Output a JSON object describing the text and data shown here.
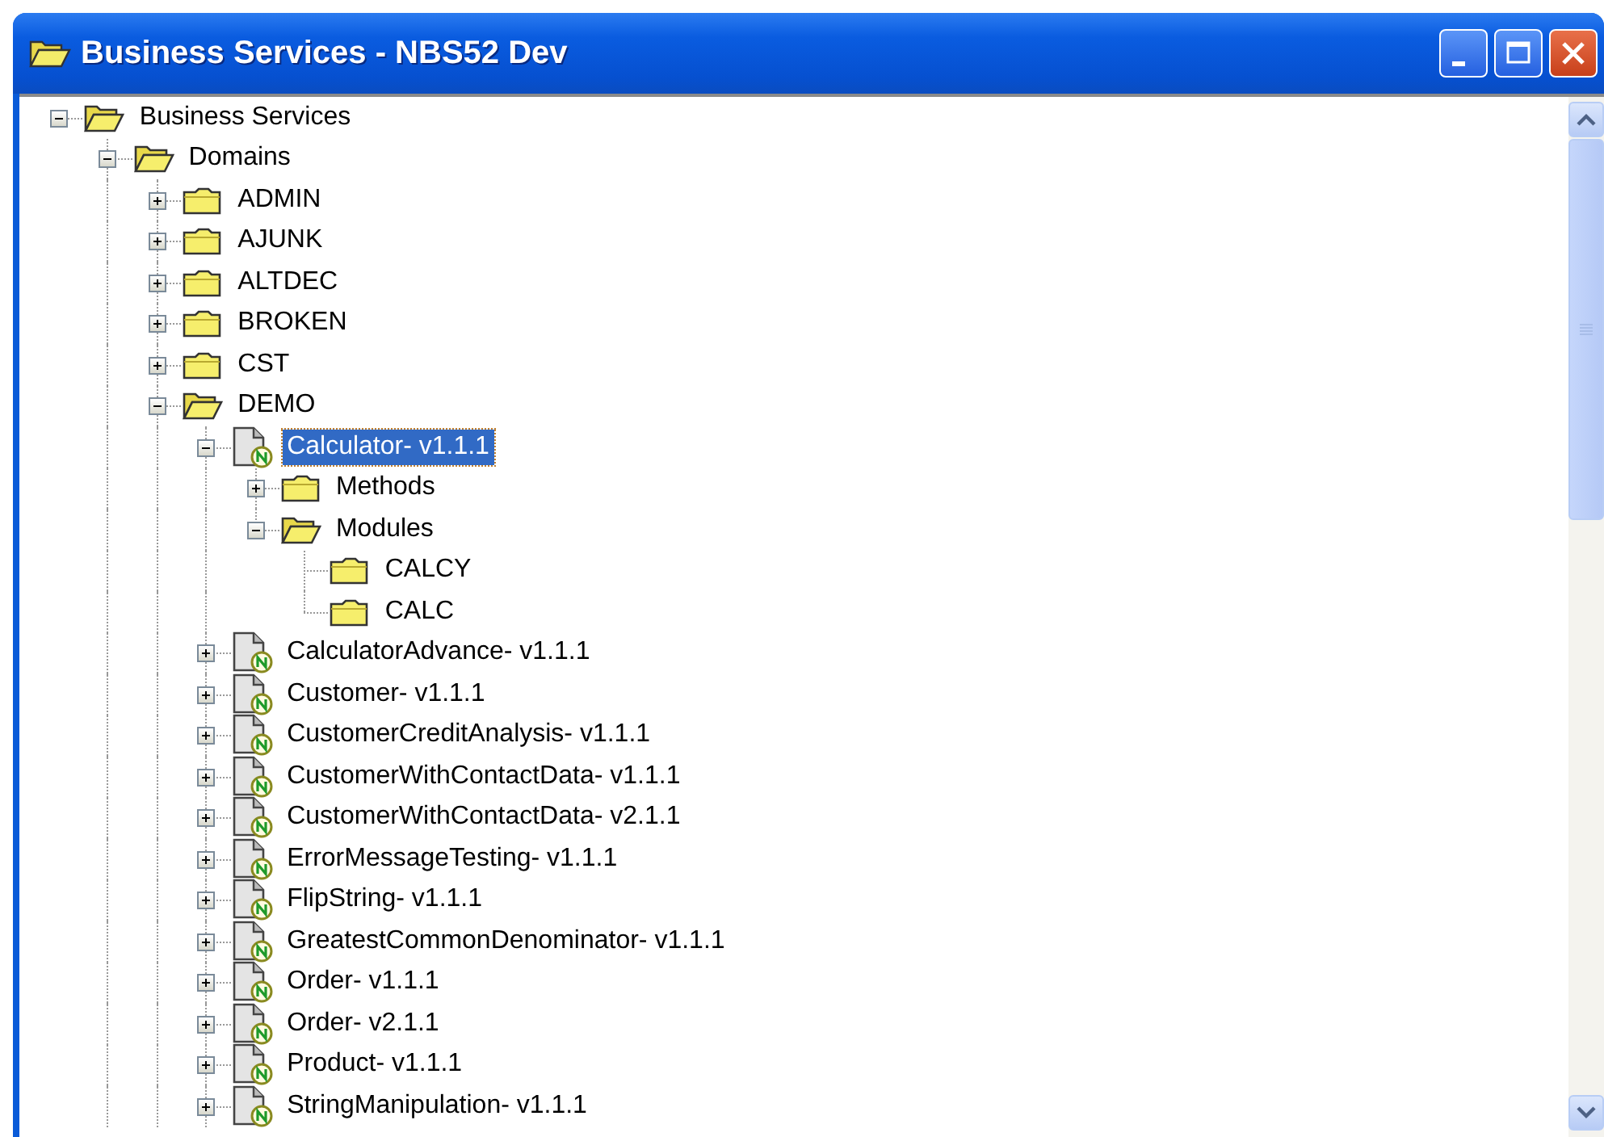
{
  "window": {
    "title": "Business Services - NBS52 Dev"
  },
  "tree": [
    {
      "label": "Business Services",
      "kind": "folder",
      "expanded": true,
      "selected": false,
      "children_continue": true,
      "children": [
        {
          "label": "Domains",
          "kind": "folder",
          "expanded": true,
          "selected": false,
          "children_continue": true,
          "children": [
            {
              "label": "ADMIN",
              "kind": "folder",
              "expanded": false,
              "selected": false
            },
            {
              "label": "AJUNK",
              "kind": "folder",
              "expanded": false,
              "selected": false
            },
            {
              "label": "ALTDEC",
              "kind": "folder",
              "expanded": false,
              "selected": false
            },
            {
              "label": "BROKEN",
              "kind": "folder",
              "expanded": false,
              "selected": false
            },
            {
              "label": "CST",
              "kind": "folder",
              "expanded": false,
              "selected": false
            },
            {
              "label": "DEMO",
              "kind": "folder",
              "expanded": true,
              "selected": false,
              "children_continue": true,
              "children": [
                {
                  "label": "Calculator- v1.1.1",
                  "kind": "service",
                  "expanded": true,
                  "selected": true,
                  "children_continue": false,
                  "children": [
                    {
                      "label": "Methods",
                      "kind": "folder",
                      "expanded": false,
                      "selected": false
                    },
                    {
                      "label": "Modules",
                      "kind": "folder",
                      "expanded": true,
                      "selected": false,
                      "children_continue": false,
                      "children": [
                        {
                          "label": "CALCY",
                          "kind": "folder",
                          "selected": false
                        },
                        {
                          "label": "CALC",
                          "kind": "folder",
                          "selected": false
                        }
                      ]
                    }
                  ]
                },
                {
                  "label": "CalculatorAdvance- v1.1.1",
                  "kind": "service",
                  "expanded": false,
                  "selected": false
                },
                {
                  "label": "Customer- v1.1.1",
                  "kind": "service",
                  "expanded": false,
                  "selected": false
                },
                {
                  "label": "CustomerCreditAnalysis- v1.1.1",
                  "kind": "service",
                  "expanded": false,
                  "selected": false
                },
                {
                  "label": "CustomerWithContactData- v1.1.1",
                  "kind": "service",
                  "expanded": false,
                  "selected": false
                },
                {
                  "label": "CustomerWithContactData- v2.1.1",
                  "kind": "service",
                  "expanded": false,
                  "selected": false
                },
                {
                  "label": "ErrorMessageTesting- v1.1.1",
                  "kind": "service",
                  "expanded": false,
                  "selected": false
                },
                {
                  "label": "FlipString- v1.1.1",
                  "kind": "service",
                  "expanded": false,
                  "selected": false
                },
                {
                  "label": "GreatestCommonDenominator- v1.1.1",
                  "kind": "service",
                  "expanded": false,
                  "selected": false
                },
                {
                  "label": "Order- v1.1.1",
                  "kind": "service",
                  "expanded": false,
                  "selected": false
                },
                {
                  "label": "Order- v2.1.1",
                  "kind": "service",
                  "expanded": false,
                  "selected": false
                },
                {
                  "label": "Product- v1.1.1",
                  "kind": "service",
                  "expanded": false,
                  "selected": false
                },
                {
                  "label": "StringManipulation- v1.1.1",
                  "kind": "service",
                  "expanded": false,
                  "selected": false
                }
              ]
            }
          ]
        }
      ]
    }
  ]
}
